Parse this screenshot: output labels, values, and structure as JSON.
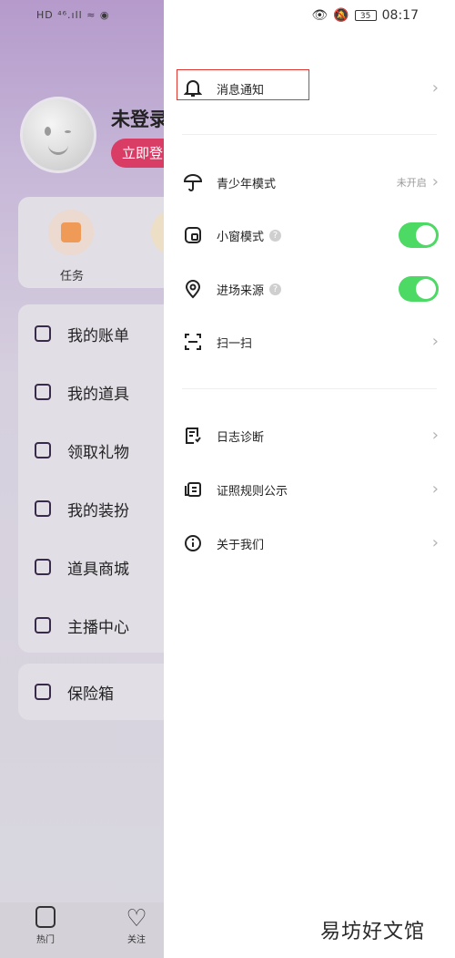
{
  "background": {
    "status_icons": "HD ⁴⁶.ıll ≈ ◉",
    "user_name": "未登录",
    "login_button": "立即登",
    "task_label": "任务",
    "menu_items": [
      "我的账单",
      "我的道具",
      "领取礼物",
      "我的装扮",
      "道具商城",
      "主播中心"
    ],
    "safe_box": "保险箱",
    "tabs": [
      "热门",
      "关注"
    ]
  },
  "status_bar": {
    "time": "08:17",
    "battery": "35"
  },
  "drawer": {
    "notification": "消息通知",
    "teen_mode": {
      "label": "青少年模式",
      "status": "未开启"
    },
    "mini_window": "小窗模式",
    "entry_source": "进场来源",
    "scan": "扫一扫",
    "log_diagnosis": "日志诊断",
    "license": "证照规则公示",
    "about": "关于我们"
  },
  "watermark": "易坊好文馆",
  "colors": {
    "toggle_on": "#4cd964",
    "highlight": "#e0362f",
    "login_bg": "#d93d66"
  }
}
